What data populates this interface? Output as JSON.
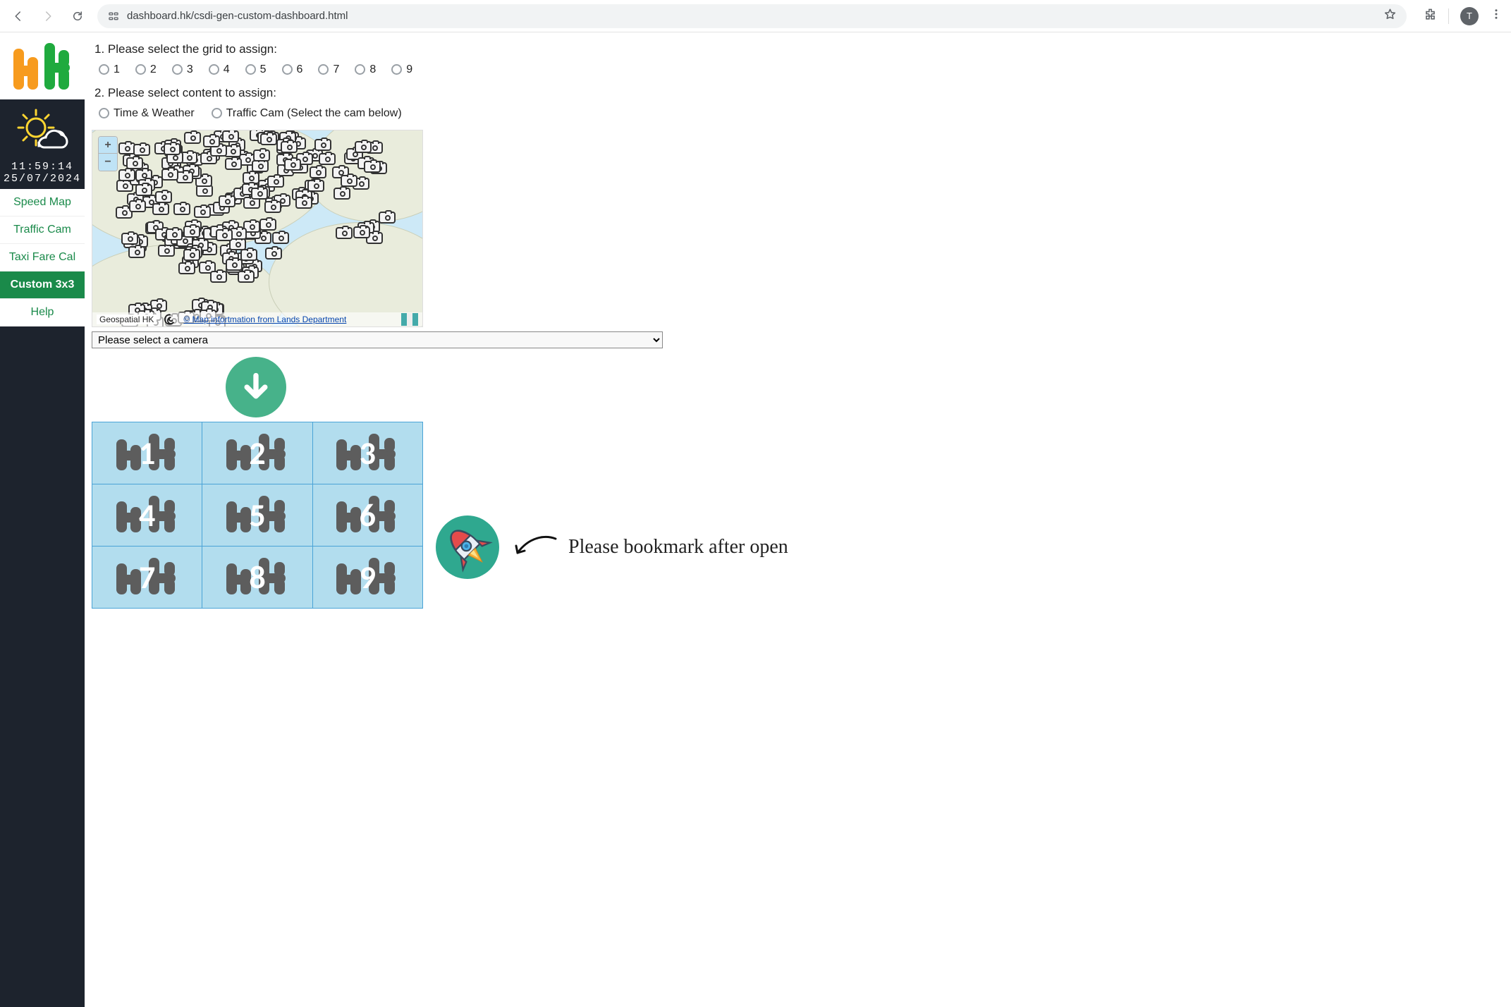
{
  "browser": {
    "url": "dashboard.hk/csdi-gen-custom-dashboard.html",
    "profile_initial": "T"
  },
  "sidebar": {
    "time": "11:59:14",
    "date": "25/07/2024",
    "nav": [
      {
        "label": "Speed Map",
        "active": false
      },
      {
        "label": "Traffic Cam",
        "active": false
      },
      {
        "label": "Taxi Fare Cal",
        "active": false
      },
      {
        "label": "Custom 3x3",
        "active": true
      },
      {
        "label": "Help",
        "active": false
      }
    ]
  },
  "form": {
    "step1_label": "1. Please select the grid to assign:",
    "grid_options": [
      "1",
      "2",
      "3",
      "4",
      "5",
      "6",
      "7",
      "8",
      "9"
    ],
    "step2_label": "2. Please select content to assign:",
    "content_options": [
      "Time & Weather",
      "Traffic Cam (Select the cam below)"
    ],
    "camera_select_placeholder": "Please select a camera",
    "map": {
      "attribution_left": "Geospatial HK",
      "attribution_link": "© Map infortmation from Lands Department",
      "zoom_in": "+",
      "zoom_out": "−"
    }
  },
  "grid_slots": [
    "1",
    "2",
    "3",
    "4",
    "5",
    "6",
    "7",
    "8",
    "9"
  ],
  "cta": {
    "bookmark_text": "Please bookmark after open"
  },
  "colors": {
    "sidebar_bg": "#1d232d",
    "accent_green": "#1a8a4a",
    "arrow_green": "#47b28a",
    "rocket_bg": "#2fa88f",
    "grid_cell_bg": "#b2ddee",
    "grid_cell_border": "#4aa3d6",
    "logo_orange": "#f79b1e",
    "logo_green": "#1faa3e"
  }
}
